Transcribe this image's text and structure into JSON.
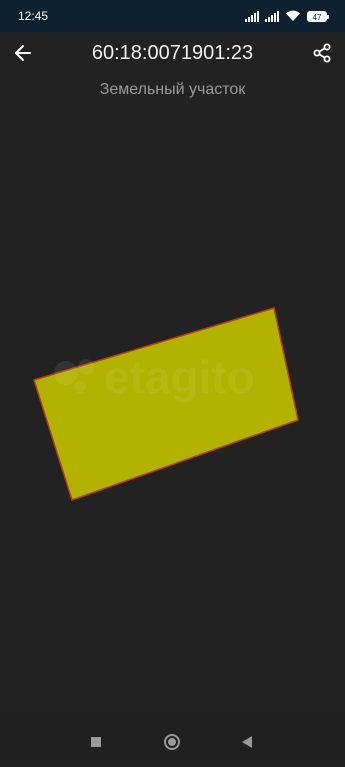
{
  "status_bar": {
    "time": "12:45",
    "battery": "47"
  },
  "header": {
    "title": "60:18:0071901:23",
    "subtitle": "Земельный участок"
  },
  "map": {
    "parcel_fill": "#b2b200",
    "parcel_stroke": "#b84000"
  },
  "watermark": {
    "text": "etagito"
  },
  "colors": {
    "status_bar": "#0d2130",
    "background": "#222222"
  }
}
